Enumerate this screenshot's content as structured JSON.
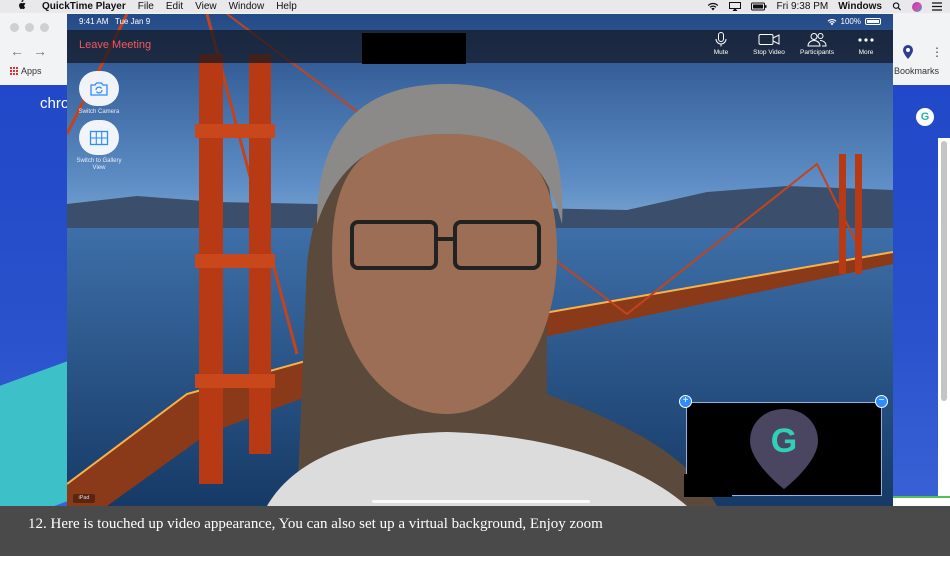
{
  "menubar": {
    "apple_icon": "apple-icon",
    "app_name": "QuickTime Player",
    "items": [
      "File",
      "Edit",
      "View",
      "Window",
      "Help"
    ],
    "clock": "Fri 9:38 PM",
    "space": "Windows"
  },
  "chrome": {
    "apps_label": "Apps",
    "bookmarks_label": "Bookmarks",
    "page_heading_fragment": "chro",
    "profile_letter": "G"
  },
  "ipad": {
    "time": "9:41 AM",
    "date": "Tue Jan 9",
    "battery": "100%",
    "device_badge": "iPad"
  },
  "zoom": {
    "leave_label": "Leave Meeting",
    "controls": [
      {
        "id": "mute",
        "label": "Mute",
        "icon": "microphone-icon"
      },
      {
        "id": "stop-video",
        "label": "Stop Video",
        "icon": "video-camera-icon"
      },
      {
        "id": "participants",
        "label": "Participants",
        "icon": "participants-icon"
      },
      {
        "id": "more",
        "label": "More",
        "icon": "more-dots-icon"
      }
    ],
    "side_buttons": [
      {
        "id": "switch-camera",
        "label": "Switch Camera",
        "icon": "camera-switch-icon"
      },
      {
        "id": "gallery-view",
        "label": "Switch to Gallery View",
        "icon": "grid-icon"
      }
    ],
    "pip_logo_letter": "G"
  },
  "caption": {
    "text": "12. Here is touched up video appearance, You can also set up a virtual background, Enjoy zoom"
  },
  "colors": {
    "leave": "#f15a5a",
    "zoom_blue": "#2d8cff",
    "logo_teal": "#2ed1b6",
    "chrome_page": "#2048c8",
    "caption_bg": "#4a4a4a"
  }
}
